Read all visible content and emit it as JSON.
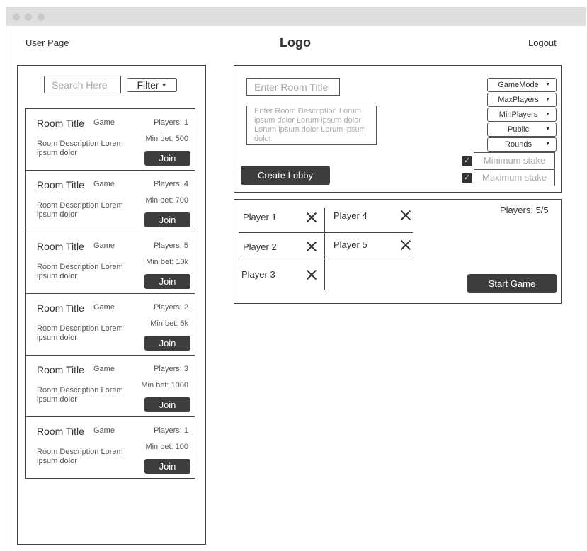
{
  "header": {
    "user_page": "User Page",
    "logo": "Logo",
    "logout": "Logout"
  },
  "sidebar": {
    "search_placeholder": "Search Here",
    "filter_label": "Filter",
    "rooms": [
      {
        "title": "Room Title",
        "game": "Game",
        "players": "Players: 1",
        "description": "Room Description Lorem ipsum dolor",
        "min_bet": "Min bet: 500",
        "join": "Join"
      },
      {
        "title": "Room Title",
        "game": "Game",
        "players": "Players: 4",
        "description": "Room Description Lorem ipsum dolor",
        "min_bet": "Min bet: 700",
        "join": "Join"
      },
      {
        "title": "Room Title",
        "game": "Game",
        "players": "Players: 5",
        "description": "Room Description Lorem ipsum dolor",
        "min_bet": "Min bet: 10k",
        "join": "Join"
      },
      {
        "title": "Room Title",
        "game": "Game",
        "players": "Players: 2",
        "description": "Room Description Lorem ipsum dolor",
        "min_bet": "Min bet: 5k",
        "join": "Join"
      },
      {
        "title": "Room Title",
        "game": "Game",
        "players": "Players: 3",
        "description": "Room Description Lorem ipsum dolor",
        "min_bet": "Min bet: 1000",
        "join": "Join"
      },
      {
        "title": "Room Title",
        "game": "Game",
        "players": "Players: 1",
        "description": "Room Description Lorem ipsum dolor",
        "min_bet": "Min bet: 100",
        "join": "Join"
      }
    ]
  },
  "create_lobby": {
    "title_placeholder": "Enter Room Title",
    "description_placeholder": "Enter Room Description Lorum ipsum dolor Lorum ipsum dolor Lorum ipsum dolor Lorum ipsum dolor",
    "create_button": "Create Lobby",
    "dropdowns": [
      "GameMode",
      "MaxPlayers",
      "MinPlayers",
      "Public",
      "Rounds"
    ],
    "min_stake": {
      "label": "Minimum stake",
      "checked": true
    },
    "max_stake": {
      "label": "Maximum stake",
      "checked": true
    }
  },
  "lobby": {
    "players": [
      "Player 1",
      "Player 2",
      "Player 3",
      "Player 4",
      "Player 5"
    ],
    "players_count": "Players: 5/5",
    "start_button": "Start Game"
  },
  "icons": {
    "remove": "close-icon",
    "checkbox": "check-icon",
    "dropdown": "caret-down-icon"
  }
}
